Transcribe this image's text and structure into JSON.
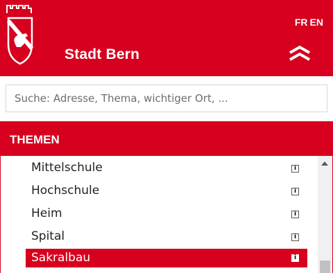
{
  "header": {
    "brand": "Stadt Bern",
    "languages": [
      "FR",
      "EN"
    ],
    "logo_icon": "bern-crest-icon",
    "collapse_icon": "double-chevron-up-icon",
    "brand_color": "#d7001e"
  },
  "search": {
    "placeholder": "Suche: Adresse, Thema, wichtiger Ort, ..."
  },
  "themen": {
    "title": "THEMEN",
    "items": [
      {
        "label": "Mittelschule",
        "info": "i",
        "selected": false
      },
      {
        "label": "Hochschule",
        "info": "i",
        "selected": false
      },
      {
        "label": "Heim",
        "info": "i",
        "selected": false
      },
      {
        "label": "Spital",
        "info": "i",
        "selected": false
      },
      {
        "label": "Sakralbau",
        "info": "i",
        "selected": true
      }
    ]
  }
}
